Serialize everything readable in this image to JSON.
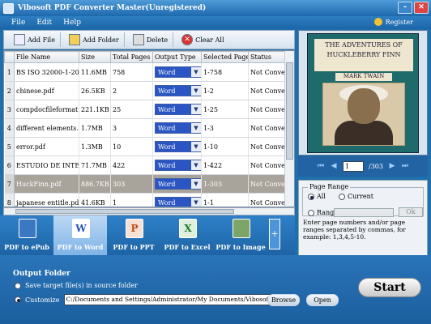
{
  "window": {
    "title": "Vibosoft PDF Converter Master(Unregistered)"
  },
  "menu": [
    "File",
    "Edit",
    "Help"
  ],
  "register_label": "Register",
  "toolbar": {
    "add_file": "Add File",
    "add_folder": "Add Folder",
    "delete": "Delete",
    "clear_all": "Clear All"
  },
  "table": {
    "headers": [
      "File Name",
      "Size",
      "Total Pages",
      "Output Type",
      "Selected Page",
      "Status"
    ],
    "rows": [
      {
        "num": "1",
        "name": "BS ISO 32000-1-2008",
        "size": "11.6MB",
        "pages": "758",
        "type": "Word",
        "selected": "1-758",
        "status": "Not Converte"
      },
      {
        "num": "2",
        "name": "chinese.pdf",
        "size": "26.5KB",
        "pages": "2",
        "type": "Word",
        "selected": "1-2",
        "status": "Not Converte"
      },
      {
        "num": "3",
        "name": "compdocfileformat.p",
        "size": "221.1KB",
        "pages": "25",
        "type": "Word",
        "selected": "1-25",
        "status": "Not Converte"
      },
      {
        "num": "4",
        "name": "different elements.p",
        "size": "1.7MB",
        "pages": "3",
        "type": "Word",
        "selected": "1-3",
        "status": "Not Converte"
      },
      {
        "num": "5",
        "name": "error.pdf",
        "size": "1.3MB",
        "pages": "10",
        "type": "Word",
        "selected": "1-10",
        "status": "Not Converte"
      },
      {
        "num": "6",
        "name": "ESTUDIO DE INTEGRAC",
        "size": "71.7MB",
        "pages": "422",
        "type": "Word",
        "selected": "1-422",
        "status": "Not Converte"
      },
      {
        "num": "7",
        "name": "HuckFinn.pdf",
        "size": "886.7KB",
        "pages": "303",
        "type": "Word",
        "selected": "1-303",
        "status": "Not Converte"
      },
      {
        "num": "8",
        "name": "japanese entitle.pd",
        "size": "41.6KB",
        "pages": "1",
        "type": "Word",
        "selected": "1-1",
        "status": "Not Converte"
      }
    ]
  },
  "preview": {
    "book_title": "THE ADVENTURES OF HUCKLEBERRY FINN",
    "book_author": "MARK TWAIN",
    "page_current": "1",
    "page_total": "/303"
  },
  "page_range": {
    "legend": "Page Range",
    "all": "All",
    "current": "Current",
    "range": "Range",
    "ok": "Ok",
    "hint": "Enter page numbers and/or page ranges separated by commas, for example: 1,3,4,5-10."
  },
  "converters": [
    "PDF to ePub",
    "PDF to Word",
    "PDF to PPT",
    "PDF to Excel",
    "PDF to Image"
  ],
  "output": {
    "heading": "Output Folder",
    "source_option": "Save target file(s) in source folder",
    "customize": "Customize",
    "path": "C:/Documents and Settings/Administrator/My Documents/Vibosoft",
    "browse": "Browse",
    "open": "Open",
    "start": "Start"
  }
}
